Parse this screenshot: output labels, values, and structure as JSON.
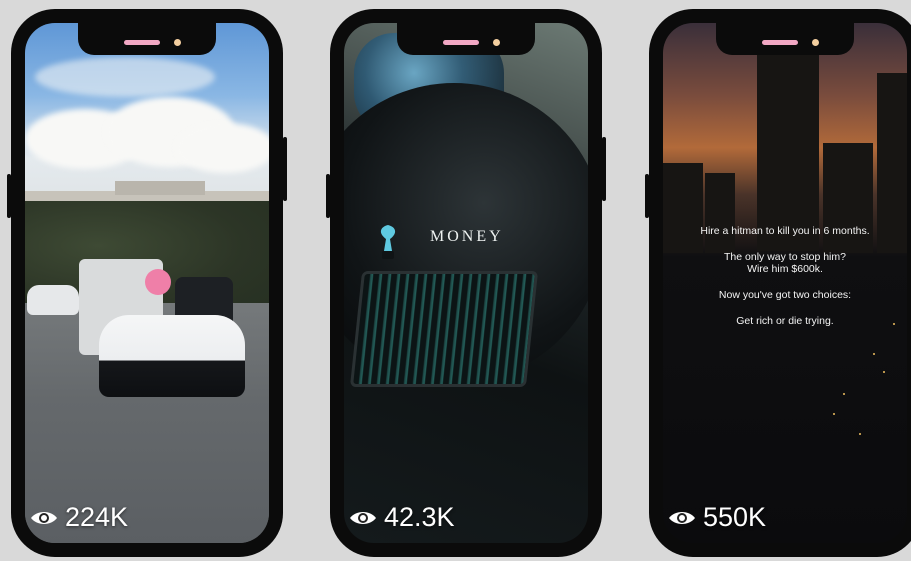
{
  "phones": [
    {
      "id": "supercar",
      "view_count": "224K",
      "icon": "eye-icon"
    },
    {
      "id": "luxury-car",
      "view_count": "42.3K",
      "icon": "eye-icon",
      "overlay_text": "MONEY"
    },
    {
      "id": "city-skyline",
      "view_count": "550K",
      "icon": "eye-icon",
      "quote_lines": [
        "Hire a hitman to kill you in 6 months.",
        "The only way to stop him?",
        "Wire him $600k.",
        "Now you've got two choices:",
        "Get rich or die trying."
      ]
    }
  ],
  "colors": {
    "background": "#d9d9d9",
    "phone_frame": "#0b0b0b",
    "notch_speaker": "#f2a8c4",
    "notch_camera": "#f4cfa0"
  }
}
